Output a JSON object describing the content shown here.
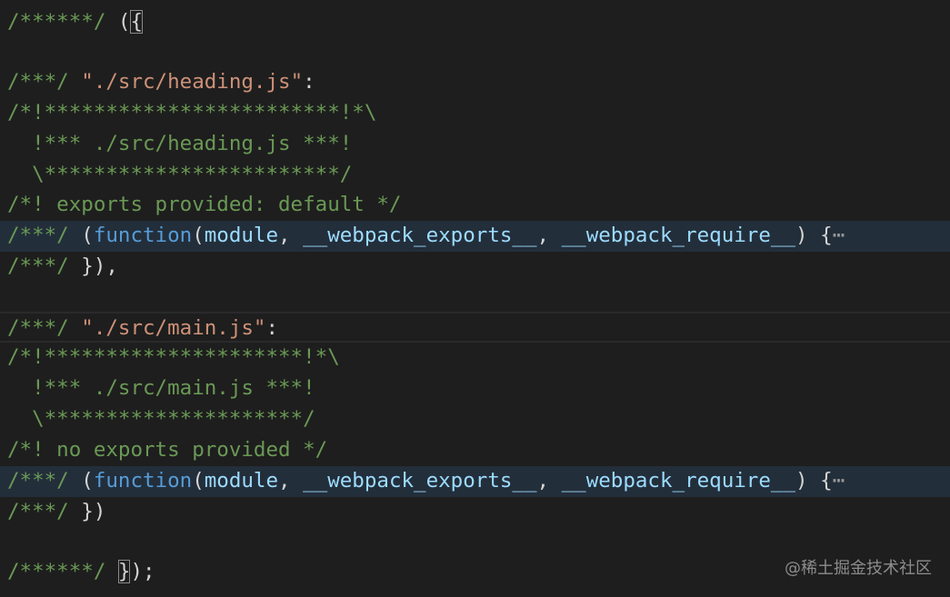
{
  "lines": [
    {
      "comment": "/******/",
      "punct": " (",
      "bracket": "{"
    },
    {},
    {
      "comment": "/***/",
      "space": " ",
      "string": "\"./src/heading.js\"",
      "punct": ":"
    },
    {
      "comment": "/*!************************!*\\"
    },
    {
      "comment": "  !*** ./src/heading.js ***!"
    },
    {
      "comment": "  \\************************/"
    },
    {
      "comment": "/*! exports provided: default */"
    },
    {
      "comment": "/***/",
      "open": " (",
      "keyword": "function",
      "paren": "(",
      "p1": "module",
      "sep1": ", ",
      "p2": "__webpack_exports__",
      "sep2": ", ",
      "p3": "__webpack_require__",
      "close": ") {",
      "fold": "⋯"
    },
    {
      "comment": "/***/",
      "punct": " }),"
    },
    {},
    {
      "comment": "/***/",
      "space": " ",
      "string": "\"./src/main.js\"",
      "punct": ":"
    },
    {
      "comment": "/*!*********************!*\\"
    },
    {
      "comment": "  !*** ./src/main.js ***!"
    },
    {
      "comment": "  \\*********************/"
    },
    {
      "comment": "/*! no exports provided */"
    },
    {
      "comment": "/***/",
      "open": " (",
      "keyword": "function",
      "paren": "(",
      "p1": "module",
      "sep1": ", ",
      "p2": "__webpack_exports__",
      "sep2": ", ",
      "p3": "__webpack_require__",
      "close": ") {",
      "fold": "⋯"
    },
    {
      "comment": "/***/",
      "punct": " })"
    },
    {},
    {
      "comment": "/******/",
      "space": " ",
      "bracket": "}",
      "punct": ");"
    }
  ],
  "watermark": "@稀土掘金技术社区"
}
